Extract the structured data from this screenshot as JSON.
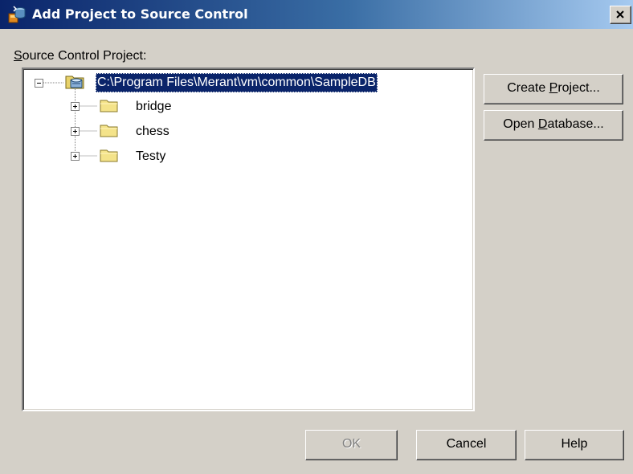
{
  "window": {
    "title": "Add Project to Source Control",
    "title_icon": "project-database-icon",
    "close_icon": "close-icon"
  },
  "tree": {
    "label_first": "S",
    "label_rest": "ource Control Project:",
    "root": {
      "label": "C:\\Program Files\\Merant\\vm\\common\\SampleDB",
      "icon": "database-icon",
      "expanded": true,
      "selected": true
    },
    "children": [
      {
        "label": "bridge",
        "icon": "folder-icon",
        "expanded": false
      },
      {
        "label": "chess",
        "icon": "folder-icon",
        "expanded": false
      },
      {
        "label": "Testy",
        "icon": "folder-icon",
        "expanded": false
      }
    ]
  },
  "buttons": {
    "create_project": {
      "pre": "Create ",
      "mnemonic": "P",
      "post": "roject..."
    },
    "open_database": {
      "pre": "Open ",
      "mnemonic": "D",
      "post": "atabase..."
    },
    "ok": {
      "label": "OK",
      "enabled": false
    },
    "cancel": {
      "label": "Cancel"
    },
    "help": {
      "label": "Help"
    }
  },
  "colors": {
    "dialog_face": "#d4d0c8",
    "titlebar_start": "#0a246a",
    "titlebar_end": "#a6caf0",
    "selection": "#0a246a",
    "folder_fill": "#f4e38a"
  }
}
